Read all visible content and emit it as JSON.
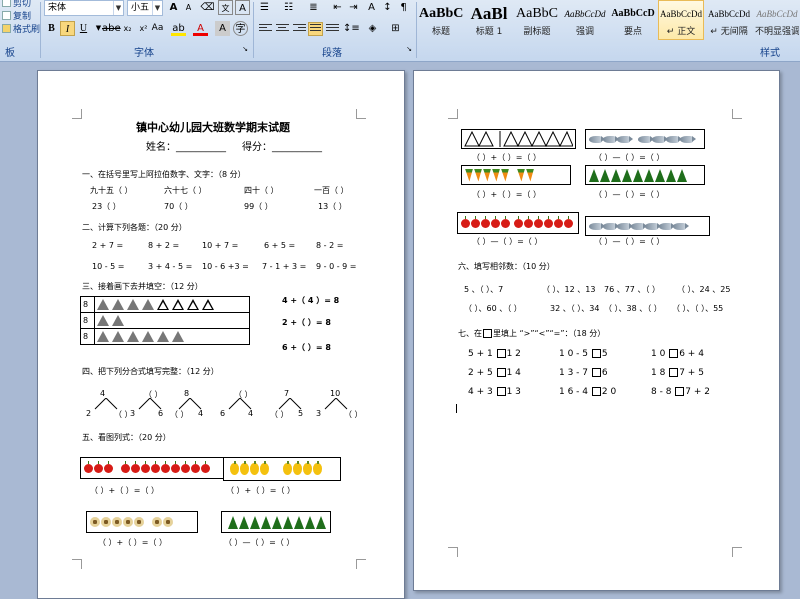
{
  "ribbon": {
    "clipboard": {
      "cut": "剪切",
      "copy": "复制",
      "format_painter": "格式刷",
      "group": "板"
    },
    "font": {
      "name": "宋体",
      "size": "小五",
      "group": "字体",
      "grow": "A",
      "shrink": "A",
      "aa": "Aa"
    },
    "paragraph": {
      "group": "段落"
    },
    "styles": {
      "group": "样式",
      "items": [
        {
          "sample": "AaBbC",
          "name": "标题"
        },
        {
          "sample": "AaBl",
          "name": "标题 1"
        },
        {
          "sample": "AaBbC",
          "name": "副标题"
        },
        {
          "sample": "AaBbCcDd",
          "name": "强调"
        },
        {
          "sample": "AaBbCcD",
          "name": "要点"
        },
        {
          "sample": "AaBbCcDd",
          "name": "↵ 正文"
        },
        {
          "sample": "AaBbCcDd",
          "name": "↵ 无间隔"
        },
        {
          "sample": "AaBbCcDd",
          "name": "不明显强调"
        }
      ]
    }
  },
  "page1": {
    "title": "镇中心幼儿园大班数学期末试题",
    "name_label": "姓名：__________",
    "score_label": "得分：__________",
    "s1": {
      "heading": "一、在括号里写上阿拉伯数字、文字：（8 分）",
      "row1": [
        "九十五（      ）",
        "六十七（      ）",
        "四十（      ）",
        "一百（      ）"
      ],
      "row2": [
        "23（          ）",
        "70（          ）",
        "99（          ）",
        "13（          ）"
      ]
    },
    "s2": {
      "heading": "二、计算下列各题：（20 分）",
      "row1": [
        "2 + 7 =",
        "8 + 2 =",
        "10 + 7 =",
        "6 + 5 =",
        "8 - 2 ="
      ],
      "row2": [
        "10 - 5 =",
        "3 + 4 - 5 =",
        "10 - 6 +3 =",
        "7 - 1 + 3 =",
        "9 - 0 - 9 ="
      ]
    },
    "s3": {
      "heading": "三、接着画下去并填空：（12 分）",
      "row_labels": [
        "8",
        "8",
        "8"
      ],
      "eq": [
        "4 +（ 4 ）= 8",
        "2 +（   ）= 8",
        "6 +（   ）= 8"
      ]
    },
    "s4": {
      "heading": "四、把下列分合式填写完整：（12 分）",
      "trees": [
        {
          "top": "4",
          "left": "2",
          "right": "（  ）"
        },
        {
          "top": "（  ）",
          "left": "3",
          "right": "6"
        },
        {
          "top": "8",
          "left": "（  ）",
          "right": "4"
        },
        {
          "top": "（  ）",
          "left": "6",
          "right": "4"
        },
        {
          "top": "7",
          "left": "（  ）",
          "right": "5"
        },
        {
          "top": "10",
          "left": "3",
          "right": "（  ）"
        }
      ]
    },
    "s5": {
      "heading": "五、看图列式：（20 分）",
      "eq_plus": "（     ）+（     ）=（     ）",
      "eq_minus": "（     ）—（     ）=（     ）"
    }
  },
  "page2": {
    "eq_plus": "（     ）+（     ）=（     ）",
    "eq_minus": "（     ）—（     ）=（     ）",
    "s6": {
      "heading": "六、填写相邻数：（10 分）",
      "row1": [
        "5 、（    ）、7",
        "（    ）、12 、13",
        "76 、77 、（    ）",
        "（    ）、24 、25"
      ],
      "row2": [
        "（    ）、60 、（    ）",
        "32 、（    ）、34",
        "（    ）、38 、（    ）",
        "（    ）、（    ）、55"
      ]
    },
    "s7": {
      "heading_pre": "七、在",
      "heading_post": "里填上 “>”“<”“=”：（18 分）",
      "rows": [
        [
          [
            "5 + 1",
            "1 2"
          ],
          [
            "1 0 - 5",
            "5"
          ],
          [
            "1 0",
            "6 + 4"
          ]
        ],
        [
          [
            "2 + 5",
            "1 4"
          ],
          [
            "1 3 - 7",
            "6"
          ],
          [
            "1 8",
            "7 + 5"
          ]
        ],
        [
          [
            "4 + 3",
            "1 3"
          ],
          [
            "1 6 - 4",
            "2 0"
          ],
          [
            "8 - 8",
            "7 + 2"
          ]
        ]
      ]
    }
  }
}
